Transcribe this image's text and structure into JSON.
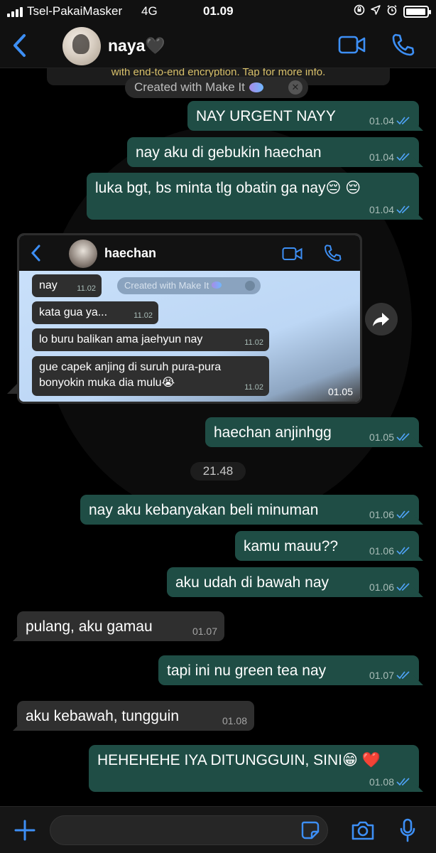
{
  "status_bar": {
    "carrier": "Tsel-PakaiMasker",
    "network": "4G",
    "time": "01.09",
    "battery_level": 0.95
  },
  "header": {
    "contact_name": "naya🖤",
    "icons": [
      "back-chevron-icon",
      "video-call-icon",
      "phone-icon"
    ]
  },
  "chat": {
    "encryption_note": "with end-to-end encryption. Tap for more info.",
    "make_it_label": "Created with Make It",
    "date_divider": "21.48",
    "messages": [
      {
        "dir": "out",
        "text": "NAY URGENT NAYY",
        "time": "01.04",
        "read": true
      },
      {
        "dir": "out",
        "text": "nay aku di gebukin haechan",
        "time": "01.04",
        "read": true
      },
      {
        "dir": "out",
        "text": "luka bgt, bs minta tlg obatin ga nay😔 😔",
        "time": "01.04",
        "read": true
      },
      {
        "dir": "out",
        "text": "haechan anjinhgg",
        "time": "01.05",
        "read": true
      },
      {
        "dir": "out",
        "text": "nay aku kebanyakan beli minuman",
        "time": "01.06",
        "read": true
      },
      {
        "dir": "out",
        "text": "kamu mauu??",
        "time": "01.06",
        "read": true
      },
      {
        "dir": "out",
        "text": "aku udah di bawah nay",
        "time": "01.06",
        "read": true
      },
      {
        "dir": "in",
        "text": "pulang, aku gamau",
        "time": "01.07"
      },
      {
        "dir": "out",
        "text": "tapi ini nu green tea nay",
        "time": "01.07",
        "read": true
      },
      {
        "dir": "in",
        "text": "aku kebawah, tungguin",
        "time": "01.08"
      },
      {
        "dir": "out",
        "text": "HEHEHEHE IYA DITUNGGUIN, SINI😁 ❤️",
        "time": "01.08",
        "read": true
      }
    ],
    "image_message": {
      "time": "01.05",
      "inner_contact": "haechan",
      "inner_make_it": "Created with Make It",
      "inner_messages": [
        {
          "text": "nay",
          "time": "11.02"
        },
        {
          "text": "kata gua ya...",
          "time": "11.02"
        },
        {
          "text": "lo buru balikan ama jaehyun nay",
          "time": "11.02"
        },
        {
          "text": "gue capek anjing di suruh pura-pura bonyokin muka dia mulu😭",
          "time": "11.02"
        }
      ]
    }
  },
  "input_bar": {
    "placeholder": "",
    "icons": [
      "plus-icon",
      "sticker-icon",
      "camera-icon",
      "microphone-icon"
    ]
  },
  "colors": {
    "accent": "#3d8ff5",
    "outgoing_bubble": "#1f4d45",
    "incoming_bubble": "#2f2f2f",
    "read_ticks": "#4fa3f7"
  }
}
